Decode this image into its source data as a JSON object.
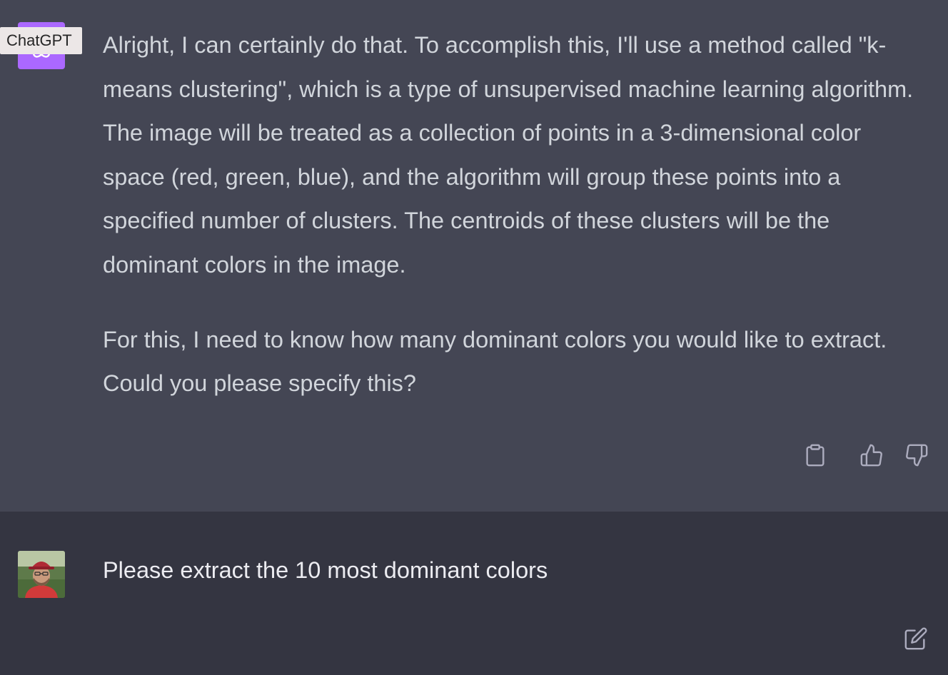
{
  "tooltip": {
    "label": "ChatGPT"
  },
  "assistant_message": {
    "paragraphs": [
      "Alright, I can certainly do that. To accomplish this, I'll use a method called \"k-means clustering\", which is a type of unsupervised machine learning algorithm. The image will be treated as a collection of points in a 3-dimensional color space (red, green, blue), and the algorithm will group these points into a specified number of clusters. The centroids of these clusters will be the dominant colors in the image.",
      "For this, I need to know how many dominant colors you would like to extract. Could you please specify this?"
    ]
  },
  "user_message": {
    "text": "Please extract the 10 most dominant colors"
  },
  "icons": {
    "avatar_bot": "openai-logo-icon",
    "copy": "clipboard-icon",
    "like": "thumbs-up-icon",
    "dislike": "thumbs-down-icon",
    "edit": "edit-icon"
  },
  "colors": {
    "assistant_bg": "#444654",
    "user_bg": "#343541",
    "bot_avatar": "#ab68ff",
    "text": "#d1d5db",
    "icon": "#acacbe"
  }
}
